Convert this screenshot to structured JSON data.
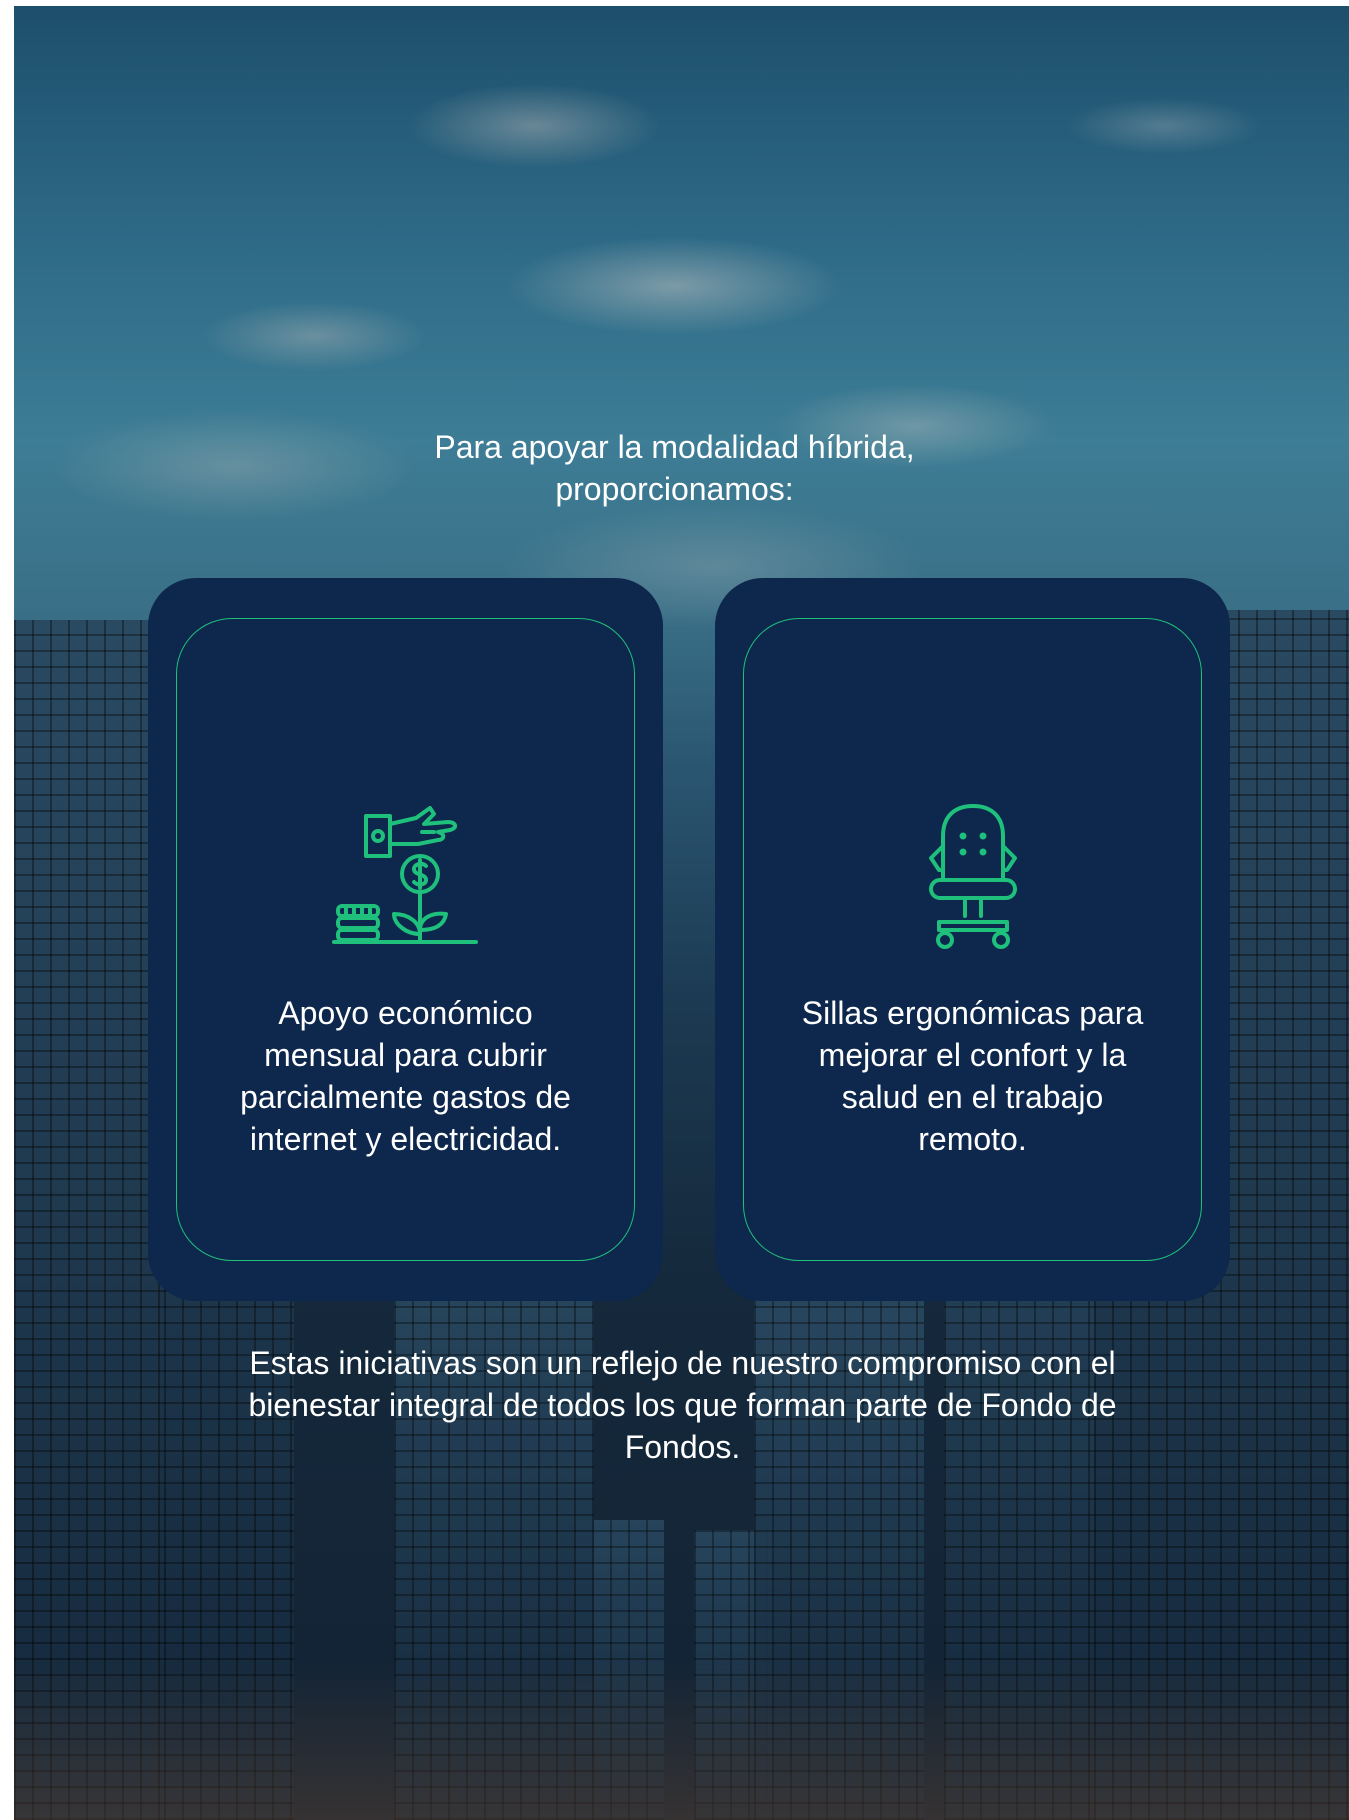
{
  "intro": {
    "line1": "Para apoyar la modalidad híbrida,",
    "line2": "proporcionamos:"
  },
  "cards": [
    {
      "icon": "hand-money-plant-icon",
      "text": "Apoyo económico mensual para cubrir parcialmente gastos de internet y electricidad."
    },
    {
      "icon": "office-chair-icon",
      "text": "Sillas ergonómicas para mejorar el confort y la salud en el trabajo remoto."
    }
  ],
  "outro": "Estas iniciativas son un reflejo de nuestro compromiso con el bienestar integral de todos los que forman parte de Fondo de Fondos.",
  "colors": {
    "card_bg": "#0d274d",
    "accent": "#1fbf7c",
    "text": "#ffffff"
  }
}
